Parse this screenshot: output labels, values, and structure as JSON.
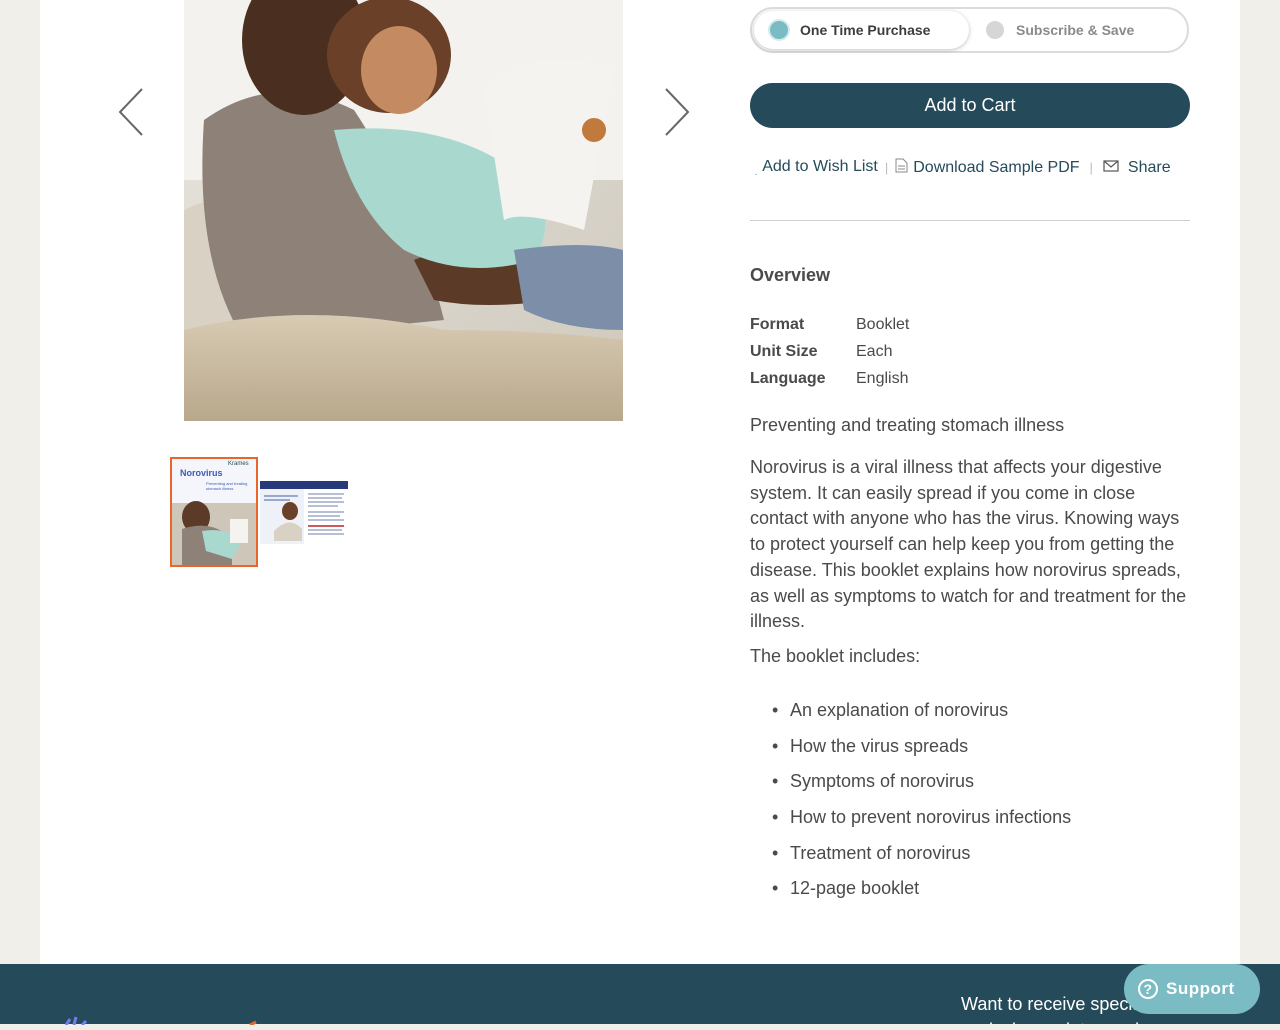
{
  "gallery": {
    "main_image_alt": "Father reading booklet with daughter on couch",
    "thumbnails": [
      {
        "title": "Norovirus",
        "subtitle": "Preventing and treating stomach illness",
        "brand": "Krames"
      },
      {
        "title": "Understanding Norovirus"
      }
    ]
  },
  "purchase": {
    "one_time_label": "One Time Purchase",
    "subscribe_label": "Subscribe & Save",
    "selected": "one_time",
    "add_to_cart_label": "Add to Cart"
  },
  "actions": {
    "wish_list_label": "Add to Wish List",
    "download_label": "Download Sample PDF",
    "share_label": "Share"
  },
  "overview": {
    "title": "Overview",
    "specs": [
      {
        "key": "Format",
        "value": "Booklet"
      },
      {
        "key": "Unit Size",
        "value": "Each"
      },
      {
        "key": "Language",
        "value": "English"
      }
    ],
    "tagline": "Preventing and treating stomach illness",
    "description": "Norovirus is a viral illness that affects your digestive system. It can easily spread if you come in close contact with anyone who has the virus. Knowing ways to protect yourself can help keep you from getting the disease. This booklet explains how norovirus spreads, as well as symptoms to watch for and treatment for the illness.",
    "includes_label": "The booklet includes:",
    "includes": [
      "An explanation of norovirus",
      "How the virus spreads",
      "Symptoms of norovirus",
      "How to prevent norovirus infections",
      "Treatment of norovirus",
      "12-page booklet"
    ]
  },
  "footer": {
    "signup_text": "Want to receive special offers and exclusive updates and"
  },
  "support": {
    "label": "Support"
  },
  "colors": {
    "brand_dark": "#254b5a",
    "accent_teal": "#7bbcc4",
    "thumb_border": "#e8662a",
    "background": "#f1efe9"
  }
}
